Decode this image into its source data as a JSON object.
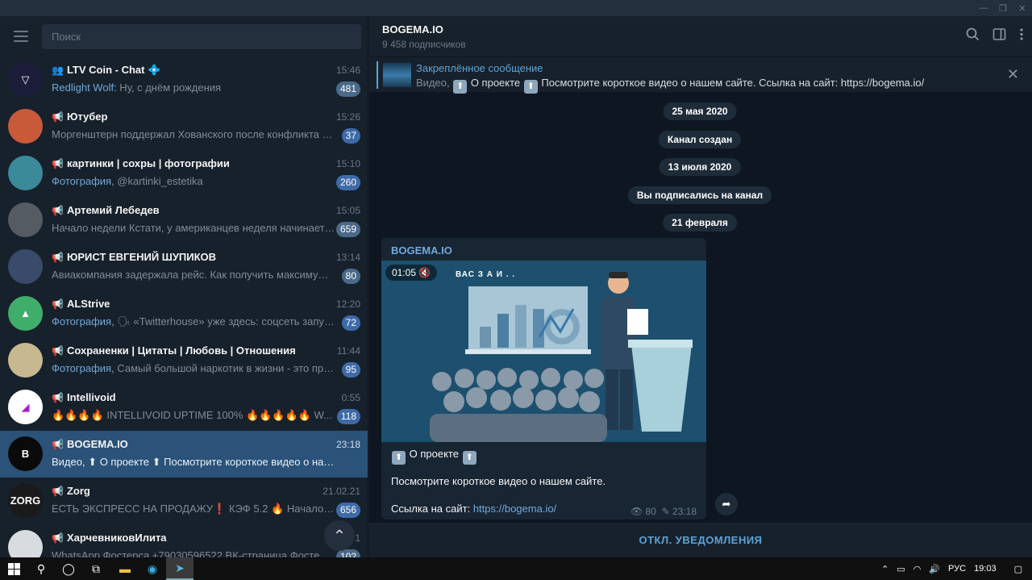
{
  "window": {
    "controls": [
      "—",
      "❐",
      "✕"
    ]
  },
  "search": {
    "placeholder": "Поиск"
  },
  "chats": [
    {
      "name": "LTV Coin - Chat 💠",
      "type_icon": "👥",
      "time": "15:46",
      "sender": "Redlight Wolf:",
      "preview": " Ну, с днём рождения",
      "badge": "481",
      "avatar_color": "#1b1d3a",
      "avatar_text": "▽"
    },
    {
      "name": "Ютубер",
      "type_icon": "📢",
      "time": "15:26",
      "sender": "",
      "preview": "Моргенштерн поддержал Хованского после конфликта со...",
      "badge": "37",
      "avatar_color": "#c85a3a",
      "avatar_text": ""
    },
    {
      "name": "картинки | сохры | фотографии",
      "type_icon": "📢",
      "time": "15:10",
      "sender": "Фотография,",
      "preview": " @kartinki_estetika",
      "badge": "260",
      "avatar_color": "#3a8a9a",
      "avatar_text": ""
    },
    {
      "name": "Артемий Лебедев",
      "type_icon": "📢",
      "time": "15:05",
      "sender": "",
      "preview": "Начало недели  Кстати, у американцев неделя начинается в...",
      "badge": "659",
      "avatar_color": "#555b62",
      "avatar_text": ""
    },
    {
      "name": "ЮРИСТ ЕВГЕНИЙ ШУПИКОВ",
      "type_icon": "📢",
      "time": "13:14",
      "sender": "",
      "preview": "Авиакомпания задержала рейс. Как получить максимум из...",
      "badge": "80",
      "avatar_color": "#3a4a6a",
      "avatar_text": ""
    },
    {
      "name": "ALStrive",
      "type_icon": "📢",
      "time": "12:20",
      "sender": "Фотография,",
      "preview": " 🗣 «Twitterhouse» уже здесь: соцсеть запусти...",
      "badge": "72",
      "avatar_color": "#3fae6a",
      "avatar_text": "▲"
    },
    {
      "name": "Сохраненки | Цитаты | Любовь | Отношения",
      "type_icon": "📢",
      "time": "11:44",
      "sender": "Фотография,",
      "preview": " Самый большой наркотик в жизни - это прив...",
      "badge": "95",
      "avatar_color": "#c8b890",
      "avatar_text": ""
    },
    {
      "name": "Intellivoid",
      "type_icon": "📢",
      "time": "0:55",
      "sender": "",
      "preview": "🔥🔥🔥🔥 INTELLIVOID UPTIME 100% 🔥🔥🔥🔥🔥 W...",
      "badge": "118",
      "avatar_color": "#ffffff",
      "avatar_text": "◢"
    },
    {
      "name": "BOGEMA.IO",
      "type_icon": "📢",
      "time": "23:18",
      "sender": "",
      "preview": "Видео, ⬆ О проекте ⬆  Посмотрите короткое видео о нашем ...",
      "badge": "",
      "avatar_color": "#0a0a0a",
      "avatar_text": "B"
    },
    {
      "name": "Zorg",
      "type_icon": "📢",
      "time": "21.02.21",
      "sender": "",
      "preview": "ЕСТЬ ЭКСПРЕСС НА ПРОДАЖУ❗  КЭФ  5.2 🔥  Начало 23:0...",
      "badge": "656",
      "avatar_color": "#1a1a1a",
      "avatar_text": "ZORG"
    },
    {
      "name": "ХарчевниковИлита",
      "type_icon": "📢",
      "time": "1",
      "sender": "",
      "preview": "WhatsApp Фостерса +79030596522 ВК-страница Фостерса h...",
      "badge": "102",
      "avatar_color": "#d8dce0",
      "avatar_text": ""
    }
  ],
  "channel": {
    "title": "BOGEMA.IO",
    "subscribers": "9 458 подписчиков"
  },
  "pinned": {
    "title": "Закреплённое сообщение",
    "prefix": "Видео,",
    "text": " О проекте ",
    "text2": "  Посмотрите короткое видео о нашем сайте.   Ссылка на сайт: https://bogema.io/"
  },
  "service": [
    {
      "label": "25 мая 2020"
    },
    {
      "label": "Канал создан"
    },
    {
      "label": "13 июля 2020"
    },
    {
      "label": "Вы подписались на канал"
    },
    {
      "label": "21 февраля"
    }
  ],
  "message": {
    "author": "BOGEMA.IO",
    "video_duration": "01:05",
    "video_caption": "ВАС  З        А     И     .     .",
    "line1": " О проекте ",
    "line2": "Посмотрите короткое видео о нашем сайте.",
    "line3_prefix": "Ссылка на сайт: ",
    "link": "https://bogema.io/",
    "views": "80",
    "time": "23:18"
  },
  "footer": {
    "label": "ОТКЛ. УВЕДОМЛЕНИЯ"
  },
  "taskbar": {
    "lang": "РУС",
    "clock": "19:03"
  },
  "colors": {
    "accent": "#5ea3d8",
    "active_row": "#2b5278",
    "bg": "#0e1621",
    "panel": "#17212b"
  }
}
